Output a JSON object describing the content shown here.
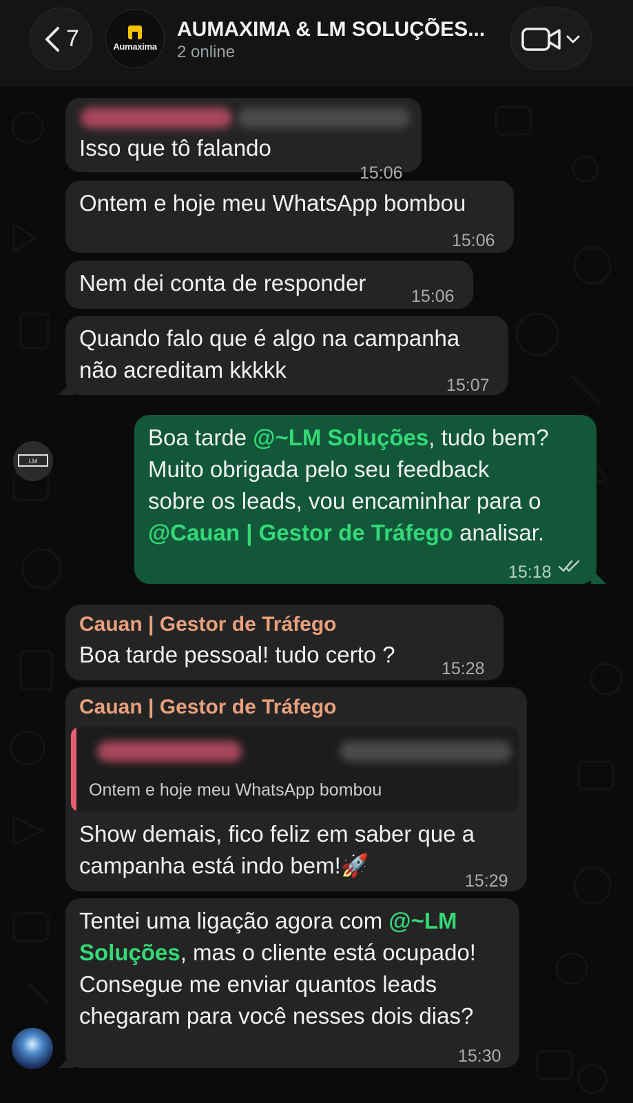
{
  "header": {
    "back_count": "7",
    "group_logo_text": "Aumaxima",
    "title": "AUMAXIMA & LM SOLUÇÕES...",
    "subtitle": "2 online",
    "video_icon": "video-camera-icon",
    "chevron_icon": "chevron-down-icon"
  },
  "messages": [
    {
      "direction": "in",
      "text": "Isso que tô falando",
      "time": "15:06"
    },
    {
      "direction": "in",
      "text": "Ontem e hoje meu WhatsApp bombou",
      "time": "15:06"
    },
    {
      "direction": "in",
      "text": "Nem dei conta de responder",
      "time": "15:06"
    },
    {
      "direction": "in",
      "line1": "Quando falo que é algo na campanha",
      "line2": "não acreditam kkkkk",
      "time": "15:07"
    },
    {
      "direction": "out",
      "l1_pre": "Boa tarde ",
      "l1_mention": "@~LM Soluções",
      "l1_post": ", tudo bem?",
      "l2": "Muito obrigada pelo seu feedback",
      "l3": "sobre os leads, vou encaminhar para o",
      "l4_mention": "@Cauan | Gestor de Tráfego",
      "l4_post": " analisar.",
      "time": "15:18"
    },
    {
      "direction": "in",
      "sender": "Cauan | Gestor de Tráfego",
      "text": "Boa tarde pessoal! tudo certo ?",
      "time": "15:28"
    },
    {
      "direction": "in",
      "sender": "Cauan | Gestor de Tráfego",
      "quote": "Ontem e hoje meu WhatsApp bombou",
      "line1": "Show demais, fico feliz em saber que a",
      "line2": "campanha está indo bem!🚀",
      "time": "15:29"
    },
    {
      "direction": "in",
      "l1_pre": "Tentei uma ligação agora com ",
      "l1_mention": "@~LM",
      "l2_mention": "Soluções",
      "l2_post": ", mas o cliente está ocupado!",
      "l3": "Consegue me enviar quantos leads",
      "l4": "chegaram para você nesses dois dias?",
      "time": "15:30"
    }
  ],
  "colors": {
    "header_bg": "#141414",
    "chat_bg": "#0b0b0b",
    "incoming_bubble": "#242424",
    "outgoing_bubble": "#12573a",
    "mention": "#34d977",
    "sender_name": "#e9a07c",
    "quote_bar": "#e85c74"
  }
}
